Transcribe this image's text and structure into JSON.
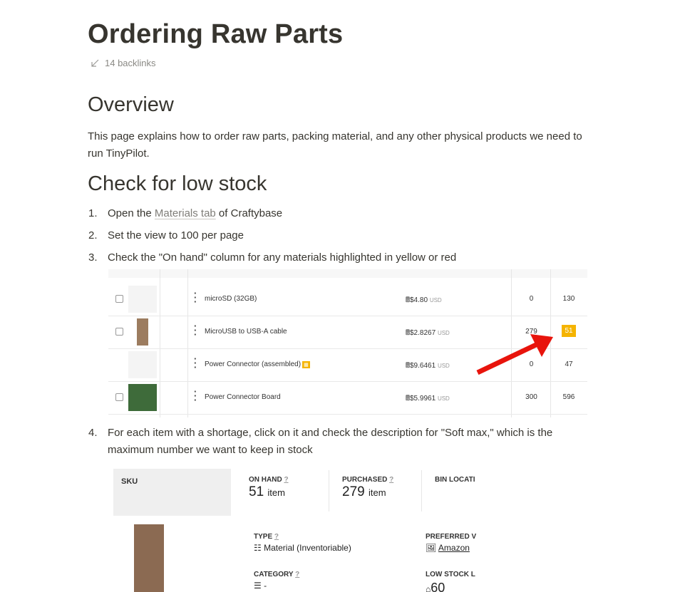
{
  "page": {
    "title": "Ordering Raw Parts",
    "backlinks": "14 backlinks"
  },
  "overview": {
    "heading": "Overview",
    "text": "This page explains how to order raw parts, packing material, and any other physical products we need to run TinyPilot."
  },
  "check": {
    "heading": "Check for low stock",
    "steps": [
      {
        "num": "1.",
        "pre": "Open the ",
        "link": "Materials tab",
        "post": " of Craftybase"
      },
      {
        "num": "2.",
        "text": "Set the view to 100 per page"
      },
      {
        "num": "3.",
        "text": "Check the \"On hand\" column for any materials highlighted in yellow or red"
      },
      {
        "num": "4.",
        "text": "For each item with a shortage, click on it and check the description for \"Soft max,\" which is the maximum number we want to keep in stock"
      }
    ]
  },
  "materials_table": {
    "rows": [
      {
        "name": "microSD (32GB)",
        "price": "$4.80",
        "currency": "USD",
        "col1": "0",
        "col2": "130",
        "highlight": false
      },
      {
        "name": "MicroUSB to USB-A cable",
        "price": "$2.8267",
        "currency": "USD",
        "col1": "279",
        "col2": "51",
        "highlight": true
      },
      {
        "name": "Power Connector (assembled)",
        "price": "$9.6461",
        "currency": "USD",
        "col1": "0",
        "col2": "47",
        "highlight": false
      },
      {
        "name": "Power Connector Board",
        "price": "$5.9961",
        "currency": "USD",
        "col1": "300",
        "col2": "596",
        "highlight": false
      }
    ],
    "highlight_color": "#f5b400",
    "arrow_color": "#e8140c"
  },
  "detail": {
    "sku_label": "SKU",
    "on_hand": {
      "label": "ON HAND",
      "q": "?",
      "value": "51",
      "unit": "item"
    },
    "purchased": {
      "label": "PURCHASED",
      "q": "?",
      "value": "279",
      "unit": "item"
    },
    "bin_location": {
      "label": "BIN LOCATI"
    },
    "type": {
      "label": "TYPE",
      "q": "?",
      "value": "Material (Inventoriable)"
    },
    "preferred_vendor": {
      "label": "PREFERRED V",
      "value": "Amazon"
    },
    "category": {
      "label": "CATEGORY",
      "q": "?",
      "value": "-"
    },
    "low_stock": {
      "label": "LOW STOCK L",
      "value": "60"
    }
  }
}
